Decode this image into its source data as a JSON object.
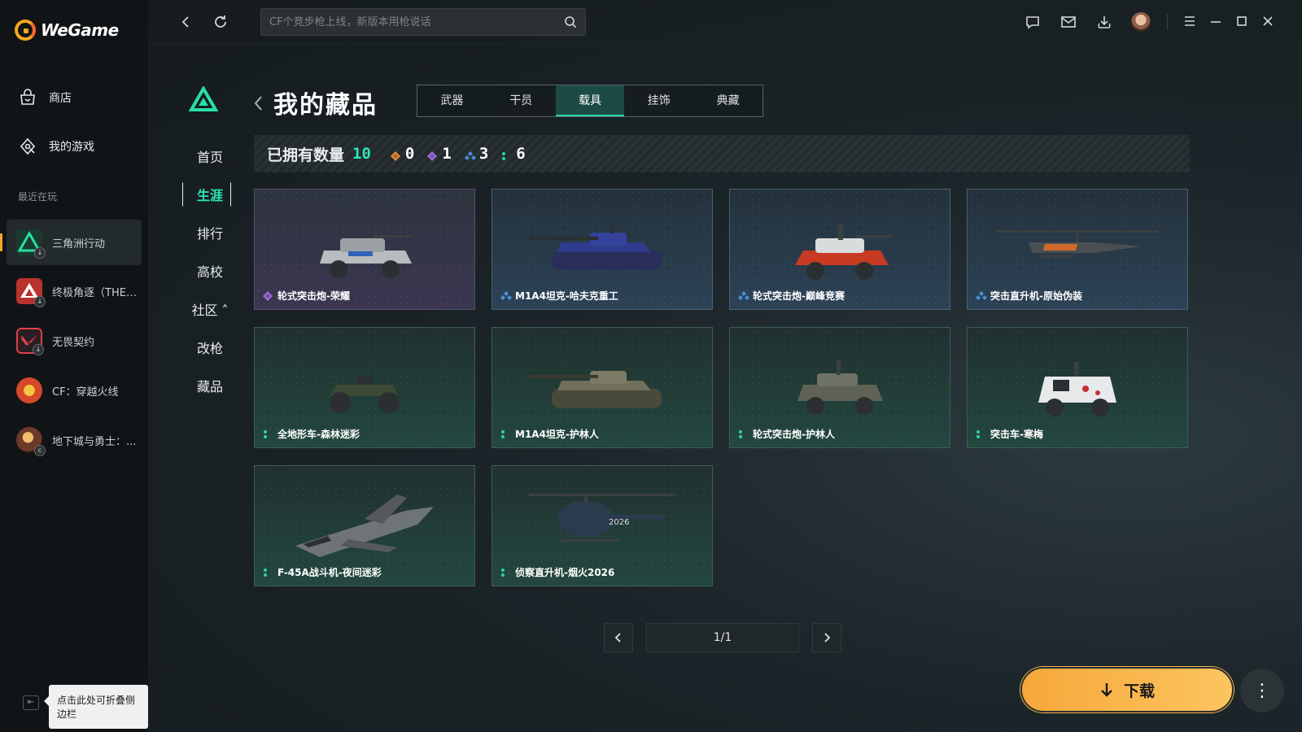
{
  "app": {
    "name": "WeGame"
  },
  "sidebar": {
    "nav": [
      {
        "label": "商店",
        "icon": "store-icon"
      },
      {
        "label": "我的游戏",
        "icon": "my-games-icon"
      }
    ],
    "recent_label": "最近在玩",
    "recent": [
      {
        "label": "三角洲行动",
        "color": "#1a3a2f",
        "accent": "#29e0a3"
      },
      {
        "label": "终极角逐（THE ...",
        "color": "#b9322d",
        "accent": "#ffffff"
      },
      {
        "label": "无畏契约",
        "color": "#e0404a",
        "accent": "#ffffff"
      },
      {
        "label": "CF：穿越火线",
        "color": "#d6482a",
        "accent": "#f4c542"
      },
      {
        "label": "地下城与勇士：...",
        "color": "#6d3a2a",
        "accent": "#f0c070"
      }
    ],
    "collapse_tooltip": "点击此处可折叠侧边栏"
  },
  "topbar": {
    "search_placeholder": "CF个竞步枪上线，新版本用枪说话"
  },
  "content": {
    "title": "我的藏品",
    "tabs": [
      "武器",
      "干员",
      "载具",
      "挂饰",
      "典藏"
    ],
    "active_tab": 2,
    "side_nav": [
      "首页",
      "生涯",
      "排行",
      "高校",
      "社区 ˄",
      "改枪",
      "藏品"
    ],
    "side_active": 1,
    "count_label": "已拥有数量",
    "count_total": "10",
    "rarity_counts": [
      {
        "icon": "orange-diamond-icon",
        "color": "#e08a3a",
        "value": "0"
      },
      {
        "icon": "purple-diamond-icon",
        "color": "#9a6cd8",
        "value": "1"
      },
      {
        "icon": "blue-triple-icon",
        "color": "#4b8fd6",
        "value": "3"
      },
      {
        "icon": "green-dots-icon",
        "color": "#2ed3a0",
        "value": "6"
      }
    ],
    "items": [
      {
        "name": "轮式突击炮-荣耀",
        "rarity": "purple",
        "art": "wheeled-assault-gun-glory"
      },
      {
        "name": "M1A4坦克-哈夫克重工",
        "rarity": "blue",
        "art": "tank-haavk"
      },
      {
        "name": "轮式突击炮-巅峰竞赛",
        "rarity": "blue",
        "art": "wheeled-assault-gun-red"
      },
      {
        "name": "突击直升机-原始伪装",
        "rarity": "blue",
        "art": "attack-helicopter"
      },
      {
        "name": "全地形车-森林迷彩",
        "rarity": "green",
        "art": "atv"
      },
      {
        "name": "M1A4坦克-护林人",
        "rarity": "green",
        "art": "tank-camo"
      },
      {
        "name": "轮式突击炮-护林人",
        "rarity": "green",
        "art": "wheeled-assault-gun-camo"
      },
      {
        "name": "突击车-寒梅",
        "rarity": "green",
        "art": "assault-vehicle-white"
      },
      {
        "name": "F-45A战斗机-夜间迷彩",
        "rarity": "green",
        "art": "fighter-jet"
      },
      {
        "name": "侦察直升机-烟火2026",
        "rarity": "green",
        "art": "scout-helicopter"
      }
    ],
    "pager": "1/1",
    "download_label": "下载",
    "more_label": "⋮"
  },
  "colors": {
    "accent_teal": "#2ee6b8",
    "download_orange": "#f6a83a"
  }
}
